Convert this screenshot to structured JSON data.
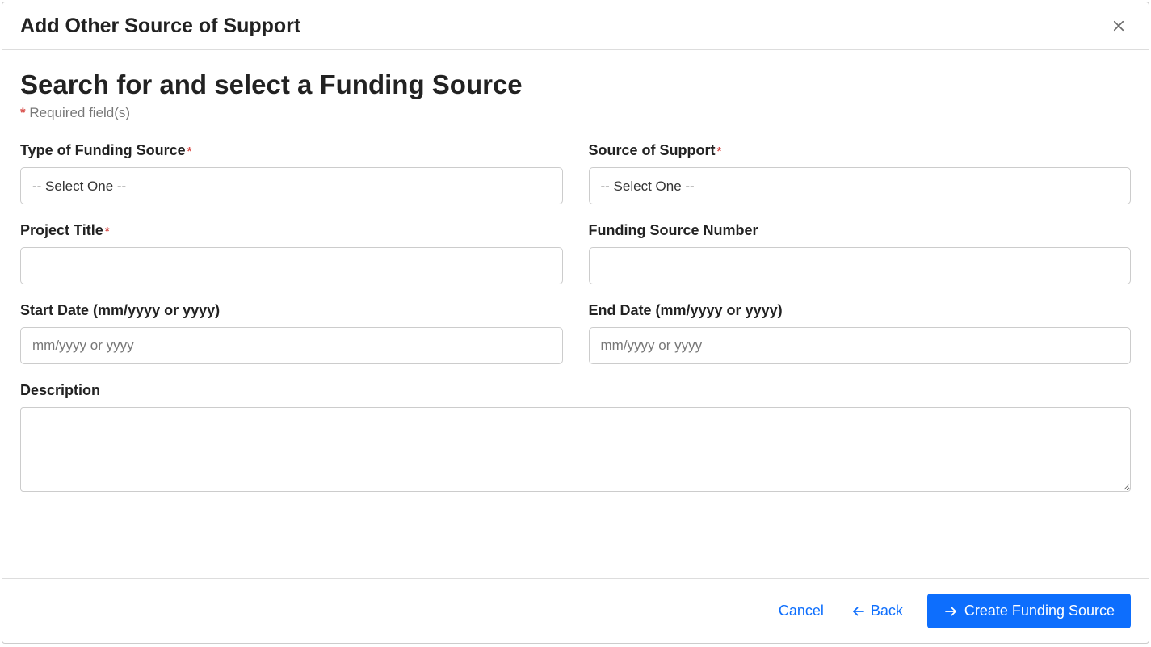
{
  "header": {
    "title": "Add Other Source of Support"
  },
  "body": {
    "heading": "Search for and select a Funding Source",
    "required_note": "Required field(s)",
    "fields": {
      "type_of_funding_source": {
        "label": "Type of Funding Source",
        "required": true,
        "selected": "-- Select One --"
      },
      "source_of_support": {
        "label": "Source of Support",
        "required": true,
        "selected": "-- Select One --"
      },
      "project_title": {
        "label": "Project Title",
        "required": true,
        "value": ""
      },
      "funding_source_number": {
        "label": "Funding Source Number",
        "required": false,
        "value": ""
      },
      "start_date": {
        "label": "Start Date (mm/yyyy or yyyy)",
        "required": false,
        "placeholder": "mm/yyyy or yyyy",
        "value": ""
      },
      "end_date": {
        "label": "End Date (mm/yyyy or yyyy)",
        "required": false,
        "placeholder": "mm/yyyy or yyyy",
        "value": ""
      },
      "description": {
        "label": "Description",
        "required": false,
        "value": ""
      }
    }
  },
  "footer": {
    "cancel": "Cancel",
    "back": "Back",
    "create": "Create Funding Source"
  }
}
